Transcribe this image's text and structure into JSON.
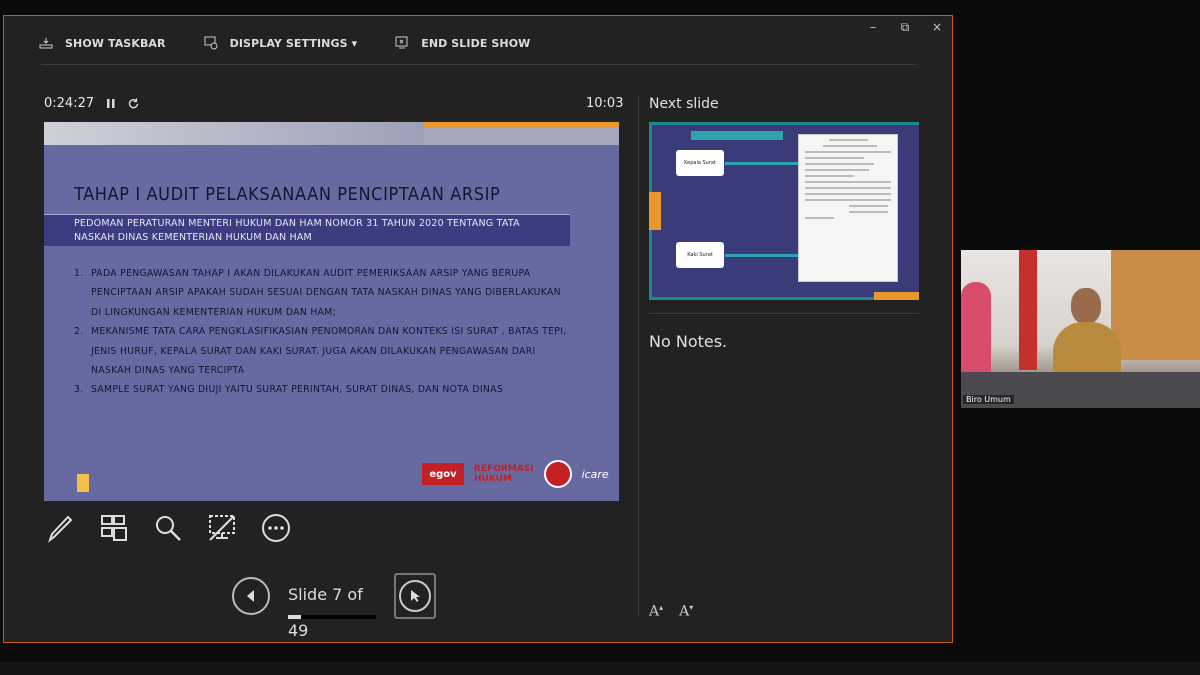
{
  "window": {
    "minimize": "–",
    "restore": "⧉",
    "close": "×"
  },
  "toolbar": {
    "show_taskbar": "SHOW TASKBAR",
    "display_settings": "DISPLAY SETTINGS ▾",
    "end_slide_show": "END SLIDE SHOW"
  },
  "timer": {
    "elapsed": "0:24:27",
    "clock": "10:03"
  },
  "slide": {
    "title": "TAHAP I AUDIT PELAKSANAAN PENCIPTAAN ARSIP",
    "banner": "PEDOMAN PERATURAN MENTERI HUKUM DAN HAM NOMOR 31 TAHUN 2020 TENTANG TATA NASKAH DINAS KEMENTERIAN HUKUM DAN HAM",
    "items": [
      {
        "num": "1.",
        "text": "PADA PENGAWASAN TAHAP I AKAN DILAKUKAN AUDIT PEMERIKSAAN ARSIP YANG BERUPA PENCIPTAAN ARSIP APAKAH SUDAH SESUAI DENGAN TATA NASKAH DINAS YANG DIBERLAKUKAN DI LINGKUNGAN KEMENTERIAN HUKUM DAN HAM;"
      },
      {
        "num": "2.",
        "text": "MEKANISME TATA CARA PENGKLASIFIKASIAN PENOMORAN DAN KONTEKS ISI SURAT , BATAS TEPI, JENIS HURUF, KEPALA SURAT DAN KAKI SURAT. JUGA AKAN DILAKUKAN PENGAWASAN DARI NASKAH DINAS YANG TERCIPTA"
      },
      {
        "num": "3.",
        "text": "SAMPLE SURAT YANG DIUJI YAITU SURAT PERINTAH, SURAT DINAS, DAN NOTA DINAS"
      }
    ],
    "logos": {
      "egov": "egov",
      "reformasi_1": "REFORMASI",
      "reformasi_2": "HUKUM",
      "icare": "icare"
    }
  },
  "navigation": {
    "slide_counter": "Slide 7 of 49",
    "current": 7,
    "total": 49
  },
  "next_slide": {
    "label": "Next slide",
    "box_1": "Kepala Surat",
    "box_2": "Kaki Surat"
  },
  "notes": {
    "text": "No Notes."
  },
  "font_controls": {
    "increase": "A",
    "decrease": "A"
  },
  "video": {
    "participant_name": "Biro Umum"
  },
  "colors": {
    "accent": "#c8541e",
    "slide_bg": "#676aa1",
    "banner": "#3b3d80",
    "teal": "#1d8a8e"
  }
}
